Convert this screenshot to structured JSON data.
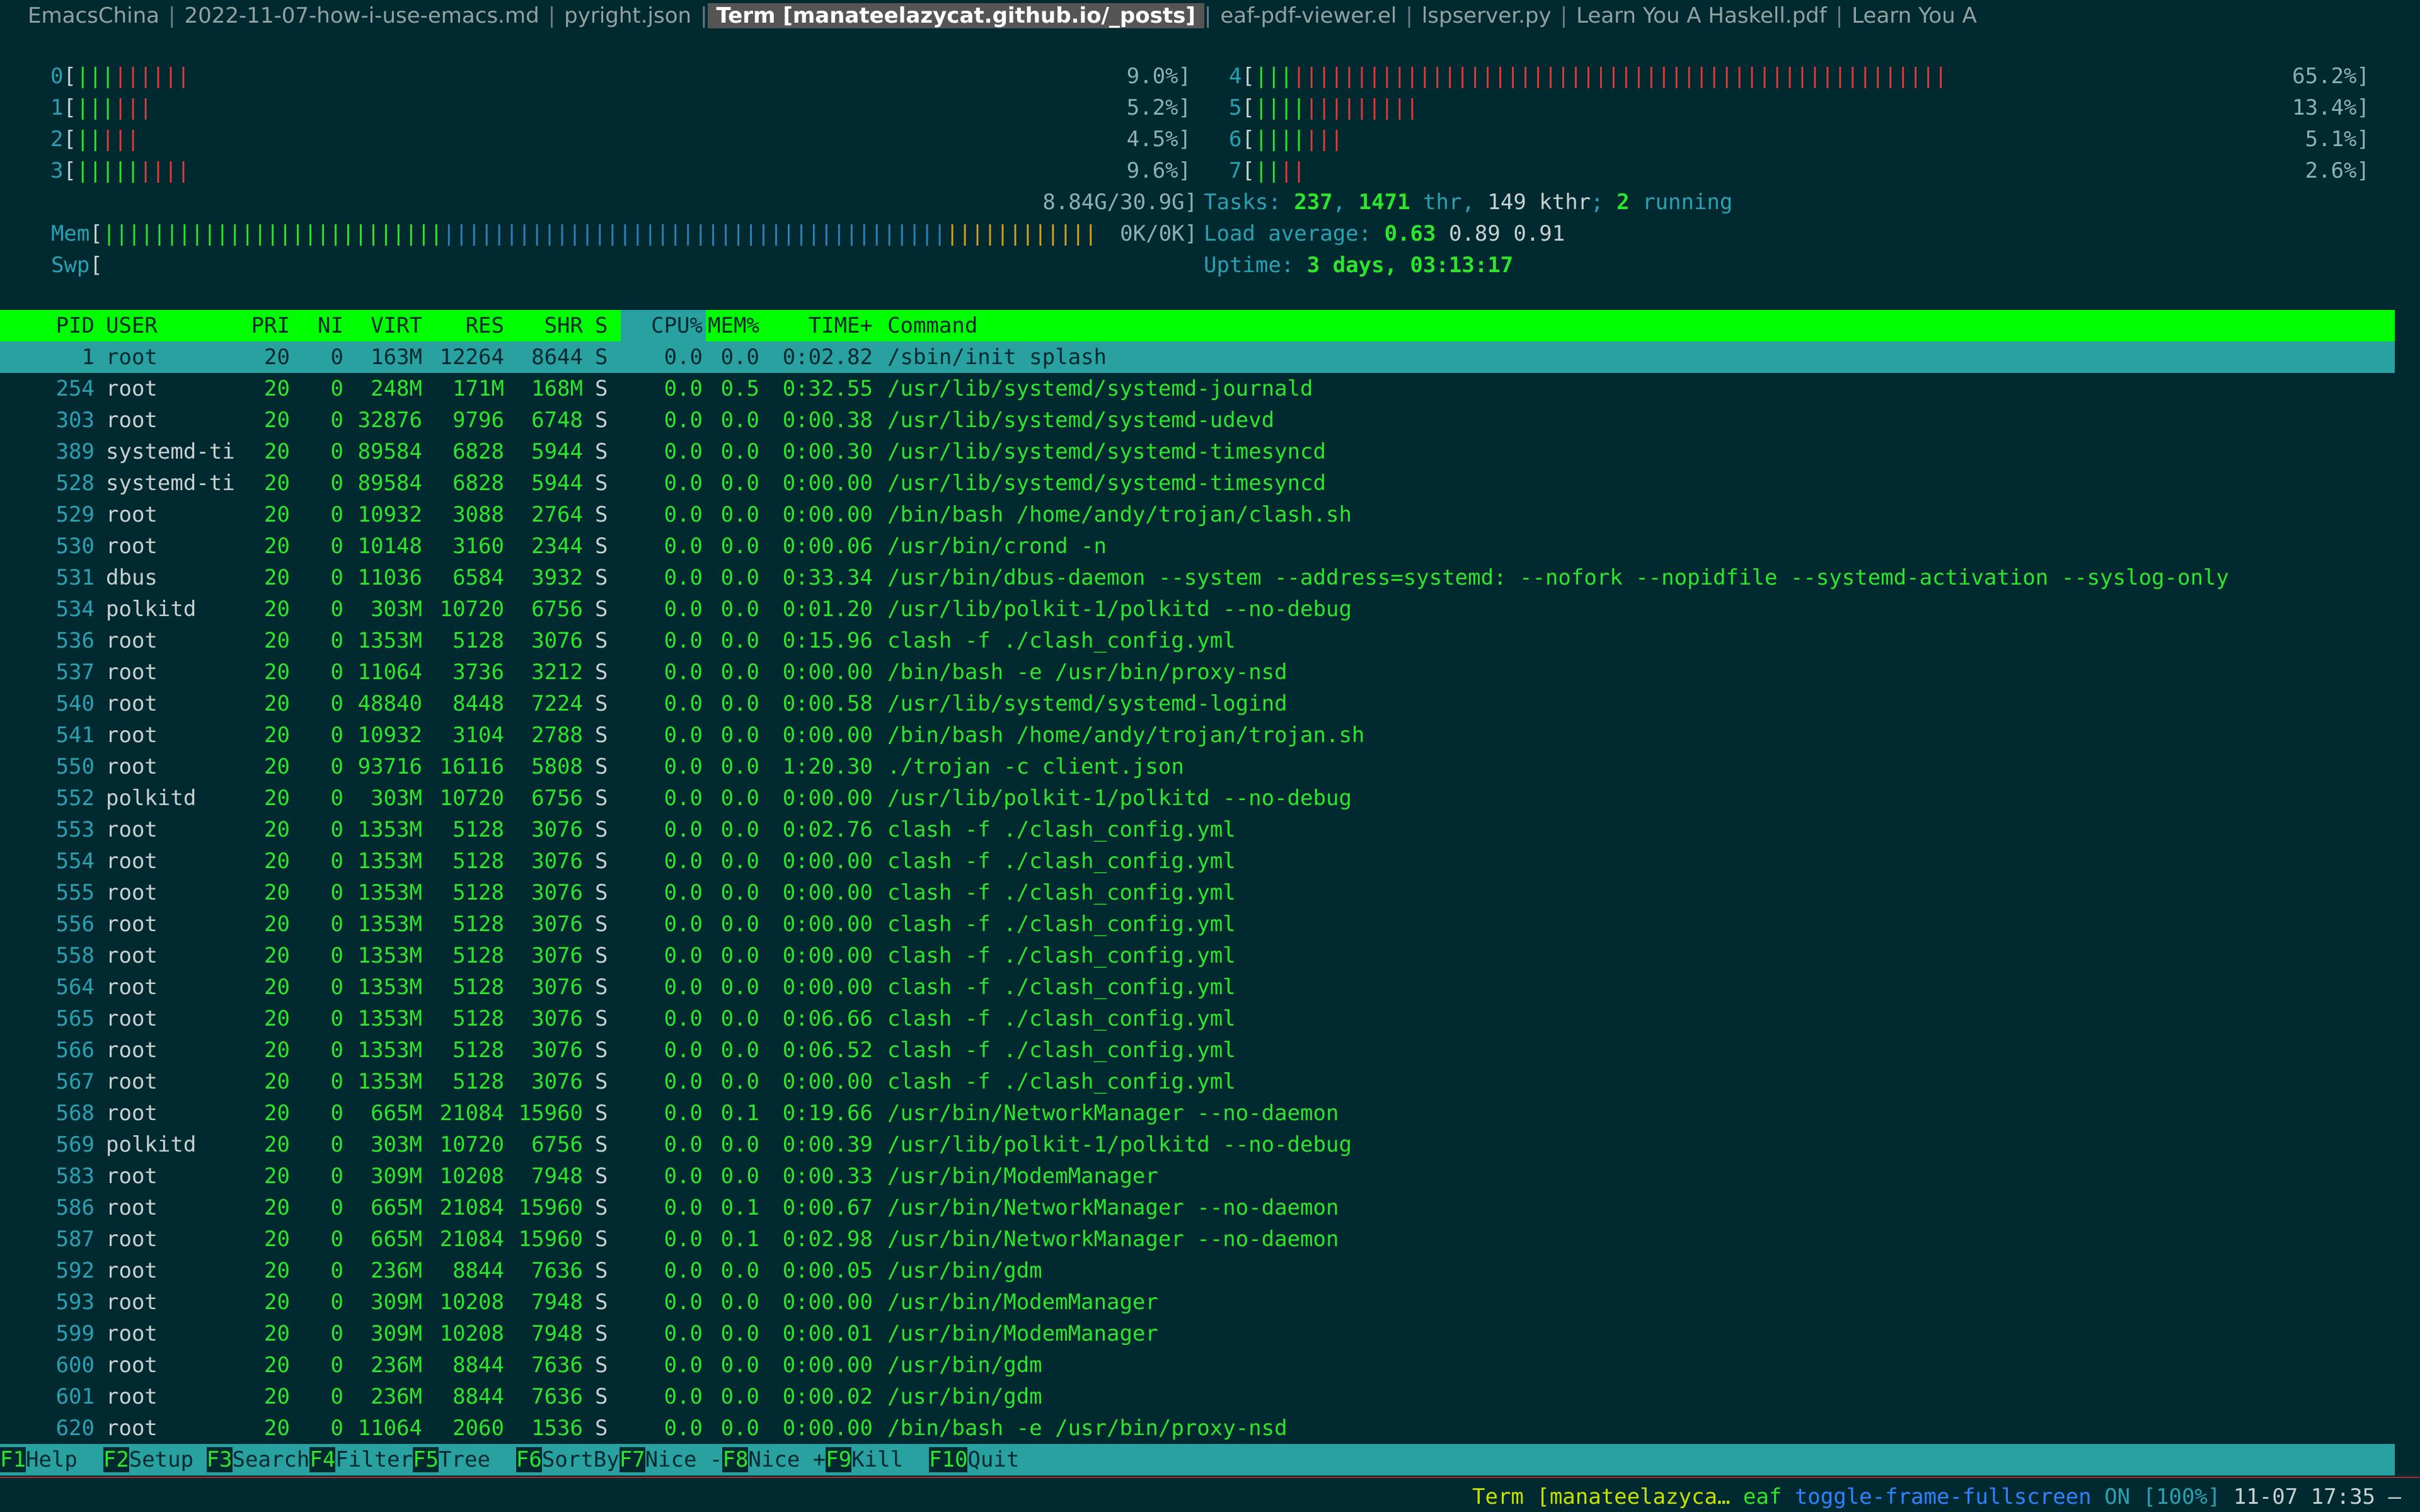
{
  "tabs": [
    {
      "label": "EmacsChina",
      "active": false
    },
    {
      "label": "2022-11-07-how-i-use-emacs.md",
      "active": false
    },
    {
      "label": "pyright.json",
      "active": false
    },
    {
      "label": "Term [manateelazycat.github.io/_posts]",
      "active": true
    },
    {
      "label": "eaf-pdf-viewer.el",
      "active": false
    },
    {
      "label": "lspserver.py",
      "active": false
    },
    {
      "label": "Learn You A Haskell.pdf",
      "active": false
    },
    {
      "label": "Learn You A",
      "active": false
    }
  ],
  "cpu_meters": [
    {
      "label": "0",
      "percent": 9.0,
      "text": "9.0%]",
      "green": 3,
      "red": 6,
      "col": "left"
    },
    {
      "label": "1",
      "percent": 5.2,
      "text": "5.2%]",
      "green": 3,
      "red": 3,
      "col": "left"
    },
    {
      "label": "2",
      "percent": 4.5,
      "text": "4.5%]",
      "green": 2,
      "red": 3,
      "col": "left"
    },
    {
      "label": "3",
      "percent": 9.6,
      "text": "9.6%]",
      "green": 5,
      "red": 4,
      "col": "left"
    },
    {
      "label": "4",
      "percent": 65.2,
      "text": "65.2%]",
      "green": 3,
      "red": 52,
      "col": "right"
    },
    {
      "label": "5",
      "percent": 13.4,
      "text": "13.4%]",
      "green": 4,
      "red": 9,
      "col": "right"
    },
    {
      "label": "6",
      "percent": 5.1,
      "text": "5.1%]",
      "green": 4,
      "red": 3,
      "col": "right"
    },
    {
      "label": "7",
      "percent": 2.6,
      "text": "2.6%]",
      "green": 2,
      "red": 2,
      "col": "right"
    }
  ],
  "memory": {
    "label": "Mem",
    "text": "8.84G/30.9G]",
    "green": 27,
    "blue": 40,
    "yellow": 12
  },
  "swap": {
    "label": "Swp",
    "text": "0K/0K]"
  },
  "tasks": {
    "prefix": "Tasks: ",
    "total": "237",
    "sep1": ", ",
    "threads": "1471",
    "thr": " thr, ",
    "kthr": "149 kthr",
    "sep2": "; ",
    "running": "2",
    "running_label": " running"
  },
  "load": {
    "prefix": "Load average: ",
    "l1": "0.63",
    "l5": "0.89",
    "l15": "0.91"
  },
  "uptime": {
    "prefix": "Uptime: ",
    "value": "3 days, 03:13:17"
  },
  "columns": {
    "pid": "PID",
    "user": "USER",
    "pri": "PRI",
    "ni": "NI",
    "virt": "VIRT",
    "res": "RES",
    "shr": "SHR",
    "s": "S",
    "cpu": "CPU%",
    "mem": "MEM%",
    "time": "TIME+",
    "command": "Command"
  },
  "processes": [
    [
      "1",
      "root",
      "20",
      "0",
      "163M",
      "12264",
      "8644",
      "S",
      "0.0",
      "0.0",
      "0:02.82",
      "/sbin/init splash"
    ],
    [
      "254",
      "root",
      "20",
      "0",
      "248M",
      "171M",
      "168M",
      "S",
      "0.0",
      "0.5",
      "0:32.55",
      "/usr/lib/systemd/systemd-journald"
    ],
    [
      "303",
      "root",
      "20",
      "0",
      "32876",
      "9796",
      "6748",
      "S",
      "0.0",
      "0.0",
      "0:00.38",
      "/usr/lib/systemd/systemd-udevd"
    ],
    [
      "389",
      "systemd-ti",
      "20",
      "0",
      "89584",
      "6828",
      "5944",
      "S",
      "0.0",
      "0.0",
      "0:00.30",
      "/usr/lib/systemd/systemd-timesyncd"
    ],
    [
      "528",
      "systemd-ti",
      "20",
      "0",
      "89584",
      "6828",
      "5944",
      "S",
      "0.0",
      "0.0",
      "0:00.00",
      "/usr/lib/systemd/systemd-timesyncd"
    ],
    [
      "529",
      "root",
      "20",
      "0",
      "10932",
      "3088",
      "2764",
      "S",
      "0.0",
      "0.0",
      "0:00.00",
      "/bin/bash /home/andy/trojan/clash.sh"
    ],
    [
      "530",
      "root",
      "20",
      "0",
      "10148",
      "3160",
      "2344",
      "S",
      "0.0",
      "0.0",
      "0:00.06",
      "/usr/bin/crond -n"
    ],
    [
      "531",
      "dbus",
      "20",
      "0",
      "11036",
      "6584",
      "3932",
      "S",
      "0.0",
      "0.0",
      "0:33.34",
      "/usr/bin/dbus-daemon --system --address=systemd: --nofork --nopidfile --systemd-activation --syslog-only"
    ],
    [
      "534",
      "polkitd",
      "20",
      "0",
      "303M",
      "10720",
      "6756",
      "S",
      "0.0",
      "0.0",
      "0:01.20",
      "/usr/lib/polkit-1/polkitd --no-debug"
    ],
    [
      "536",
      "root",
      "20",
      "0",
      "1353M",
      "5128",
      "3076",
      "S",
      "0.0",
      "0.0",
      "0:15.96",
      "clash -f ./clash_config.yml"
    ],
    [
      "537",
      "root",
      "20",
      "0",
      "11064",
      "3736",
      "3212",
      "S",
      "0.0",
      "0.0",
      "0:00.00",
      "/bin/bash -e /usr/bin/proxy-nsd"
    ],
    [
      "540",
      "root",
      "20",
      "0",
      "48840",
      "8448",
      "7224",
      "S",
      "0.0",
      "0.0",
      "0:00.58",
      "/usr/lib/systemd/systemd-logind"
    ],
    [
      "541",
      "root",
      "20",
      "0",
      "10932",
      "3104",
      "2788",
      "S",
      "0.0",
      "0.0",
      "0:00.00",
      "/bin/bash /home/andy/trojan/trojan.sh"
    ],
    [
      "550",
      "root",
      "20",
      "0",
      "93716",
      "16116",
      "5808",
      "S",
      "0.0",
      "0.0",
      "1:20.30",
      "./trojan -c client.json"
    ],
    [
      "552",
      "polkitd",
      "20",
      "0",
      "303M",
      "10720",
      "6756",
      "S",
      "0.0",
      "0.0",
      "0:00.00",
      "/usr/lib/polkit-1/polkitd --no-debug"
    ],
    [
      "553",
      "root",
      "20",
      "0",
      "1353M",
      "5128",
      "3076",
      "S",
      "0.0",
      "0.0",
      "0:02.76",
      "clash -f ./clash_config.yml"
    ],
    [
      "554",
      "root",
      "20",
      "0",
      "1353M",
      "5128",
      "3076",
      "S",
      "0.0",
      "0.0",
      "0:00.00",
      "clash -f ./clash_config.yml"
    ],
    [
      "555",
      "root",
      "20",
      "0",
      "1353M",
      "5128",
      "3076",
      "S",
      "0.0",
      "0.0",
      "0:00.00",
      "clash -f ./clash_config.yml"
    ],
    [
      "556",
      "root",
      "20",
      "0",
      "1353M",
      "5128",
      "3076",
      "S",
      "0.0",
      "0.0",
      "0:00.00",
      "clash -f ./clash_config.yml"
    ],
    [
      "558",
      "root",
      "20",
      "0",
      "1353M",
      "5128",
      "3076",
      "S",
      "0.0",
      "0.0",
      "0:00.00",
      "clash -f ./clash_config.yml"
    ],
    [
      "564",
      "root",
      "20",
      "0",
      "1353M",
      "5128",
      "3076",
      "S",
      "0.0",
      "0.0",
      "0:00.00",
      "clash -f ./clash_config.yml"
    ],
    [
      "565",
      "root",
      "20",
      "0",
      "1353M",
      "5128",
      "3076",
      "S",
      "0.0",
      "0.0",
      "0:06.66",
      "clash -f ./clash_config.yml"
    ],
    [
      "566",
      "root",
      "20",
      "0",
      "1353M",
      "5128",
      "3076",
      "S",
      "0.0",
      "0.0",
      "0:06.52",
      "clash -f ./clash_config.yml"
    ],
    [
      "567",
      "root",
      "20",
      "0",
      "1353M",
      "5128",
      "3076",
      "S",
      "0.0",
      "0.0",
      "0:00.00",
      "clash -f ./clash_config.yml"
    ],
    [
      "568",
      "root",
      "20",
      "0",
      "665M",
      "21084",
      "15960",
      "S",
      "0.0",
      "0.1",
      "0:19.66",
      "/usr/bin/NetworkManager --no-daemon"
    ],
    [
      "569",
      "polkitd",
      "20",
      "0",
      "303M",
      "10720",
      "6756",
      "S",
      "0.0",
      "0.0",
      "0:00.39",
      "/usr/lib/polkit-1/polkitd --no-debug"
    ],
    [
      "583",
      "root",
      "20",
      "0",
      "309M",
      "10208",
      "7948",
      "S",
      "0.0",
      "0.0",
      "0:00.33",
      "/usr/bin/ModemManager"
    ],
    [
      "586",
      "root",
      "20",
      "0",
      "665M",
      "21084",
      "15960",
      "S",
      "0.0",
      "0.1",
      "0:00.67",
      "/usr/bin/NetworkManager --no-daemon"
    ],
    [
      "587",
      "root",
      "20",
      "0",
      "665M",
      "21084",
      "15960",
      "S",
      "0.0",
      "0.1",
      "0:02.98",
      "/usr/bin/NetworkManager --no-daemon"
    ],
    [
      "592",
      "root",
      "20",
      "0",
      "236M",
      "8844",
      "7636",
      "S",
      "0.0",
      "0.0",
      "0:00.05",
      "/usr/bin/gdm"
    ],
    [
      "593",
      "root",
      "20",
      "0",
      "309M",
      "10208",
      "7948",
      "S",
      "0.0",
      "0.0",
      "0:00.00",
      "/usr/bin/ModemManager"
    ],
    [
      "599",
      "root",
      "20",
      "0",
      "309M",
      "10208",
      "7948",
      "S",
      "0.0",
      "0.0",
      "0:00.01",
      "/usr/bin/ModemManager"
    ],
    [
      "600",
      "root",
      "20",
      "0",
      "236M",
      "8844",
      "7636",
      "S",
      "0.0",
      "0.0",
      "0:00.00",
      "/usr/bin/gdm"
    ],
    [
      "601",
      "root",
      "20",
      "0",
      "236M",
      "8844",
      "7636",
      "S",
      "0.0",
      "0.0",
      "0:00.02",
      "/usr/bin/gdm"
    ],
    [
      "620",
      "root",
      "20",
      "0",
      "11064",
      "2060",
      "1536",
      "S",
      "0.0",
      "0.0",
      "0:00.00",
      "/bin/bash -e /usr/bin/proxy-nsd"
    ]
  ],
  "selected_pid": "1",
  "function_keys": [
    {
      "key": "F1",
      "label": "Help  "
    },
    {
      "key": "F2",
      "label": "Setup "
    },
    {
      "key": "F3",
      "label": "Search"
    },
    {
      "key": "F4",
      "label": "Filter"
    },
    {
      "key": "F5",
      "label": "Tree  "
    },
    {
      "key": "F6",
      "label": "SortBy"
    },
    {
      "key": "F7",
      "label": "Nice -"
    },
    {
      "key": "F8",
      "label": "Nice +"
    },
    {
      "key": "F9",
      "label": "Kill  "
    },
    {
      "key": "F10",
      "label": "Quit"
    }
  ],
  "modeline": {
    "buffer": "Term [manateelazyca…",
    "mode": "eaf",
    "command": "toggle-frame-fullscreen",
    "state": "ON",
    "zoom": "[100%]",
    "clock": "11-07 17:35",
    "end": "—"
  },
  "colors": {
    "bg": "#002930",
    "green": "#2ee52e",
    "red": "#e03a3a",
    "cyan": "#2aa1b3",
    "header": "#00ff00"
  }
}
